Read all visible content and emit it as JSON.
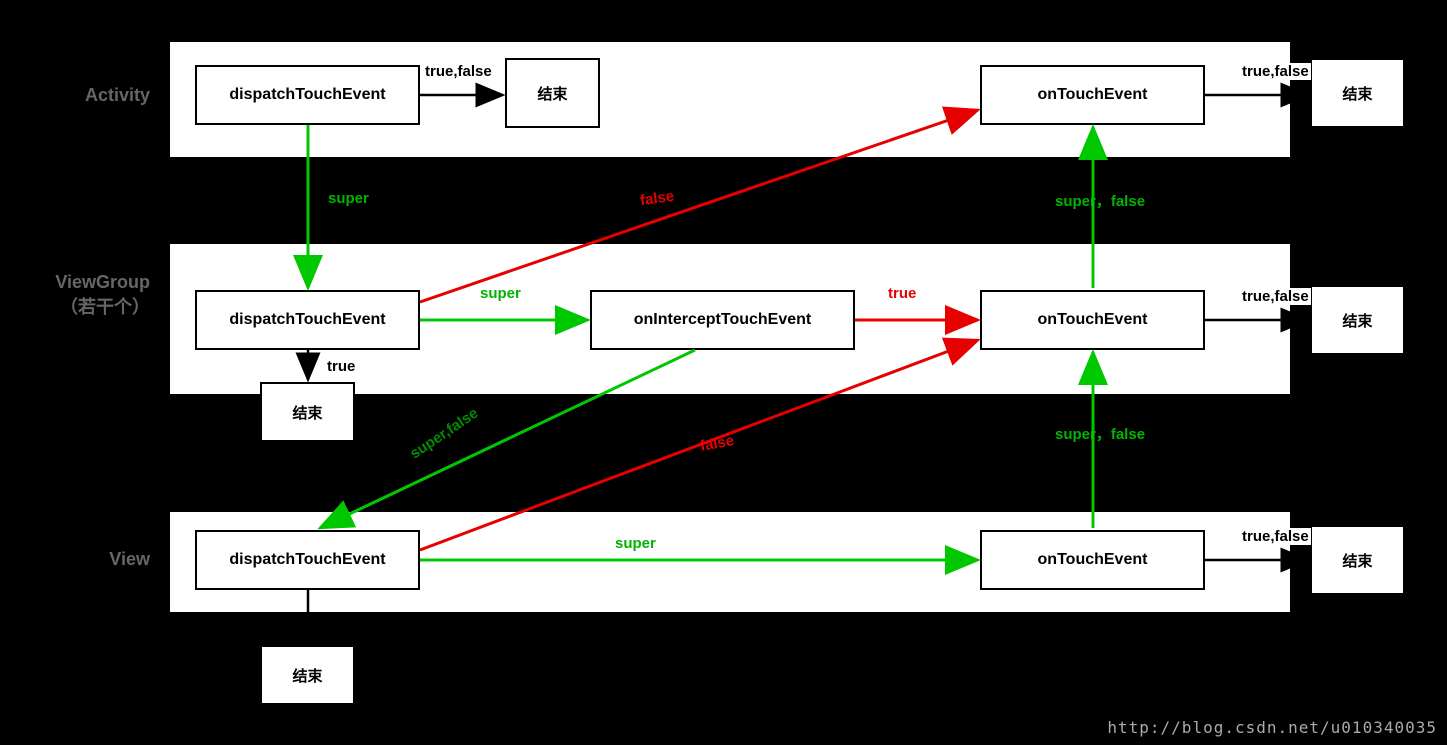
{
  "lanes": {
    "activity": {
      "label": "Activity"
    },
    "viewgroup": {
      "label": "ViewGroup",
      "sublabel": "（若干个）"
    },
    "view": {
      "label": "View"
    }
  },
  "nodes": {
    "activity_dispatch": "dispatchTouchEvent",
    "activity_end1": "结束",
    "activity_onTouch": "onTouchEvent",
    "activity_end2": "结束",
    "vg_dispatch": "dispatchTouchEvent",
    "vg_intercept": "onInterceptTouchEvent",
    "vg_onTouch": "onTouchEvent",
    "vg_end_small": "结束",
    "vg_end2": "结束",
    "view_dispatch": "dispatchTouchEvent",
    "view_onTouch": "onTouchEvent",
    "view_end_small": "结束",
    "view_end2": "结束"
  },
  "edge_labels": {
    "act_dispatch_end": "true,false",
    "act_ontouch_end": "true,false",
    "act_super_down": "super",
    "vg_dispatch_false_to_act_ontouch": "false",
    "vg_ontouch_super_false": "super，false",
    "vg_dispatch_super_to_intercept": "super",
    "vg_intercept_true_to_ontouch": "true",
    "vg_ontouch_end": "true,false",
    "vg_dispatch_true_end": "true",
    "vg_intercept_superfalse_down": "super,false",
    "view_dispatch_false_to_vg_ontouch": "false",
    "view_ontouch_super_false": "super，false",
    "view_dispatch_super_to_ontouch": "super",
    "view_ontouch_end": "true,false"
  },
  "watermark": "http://blog.csdn.net/u010340035",
  "colors": {
    "green": "#00c800",
    "green_dark": "#008c00",
    "red": "#e60000",
    "black": "#000000"
  }
}
